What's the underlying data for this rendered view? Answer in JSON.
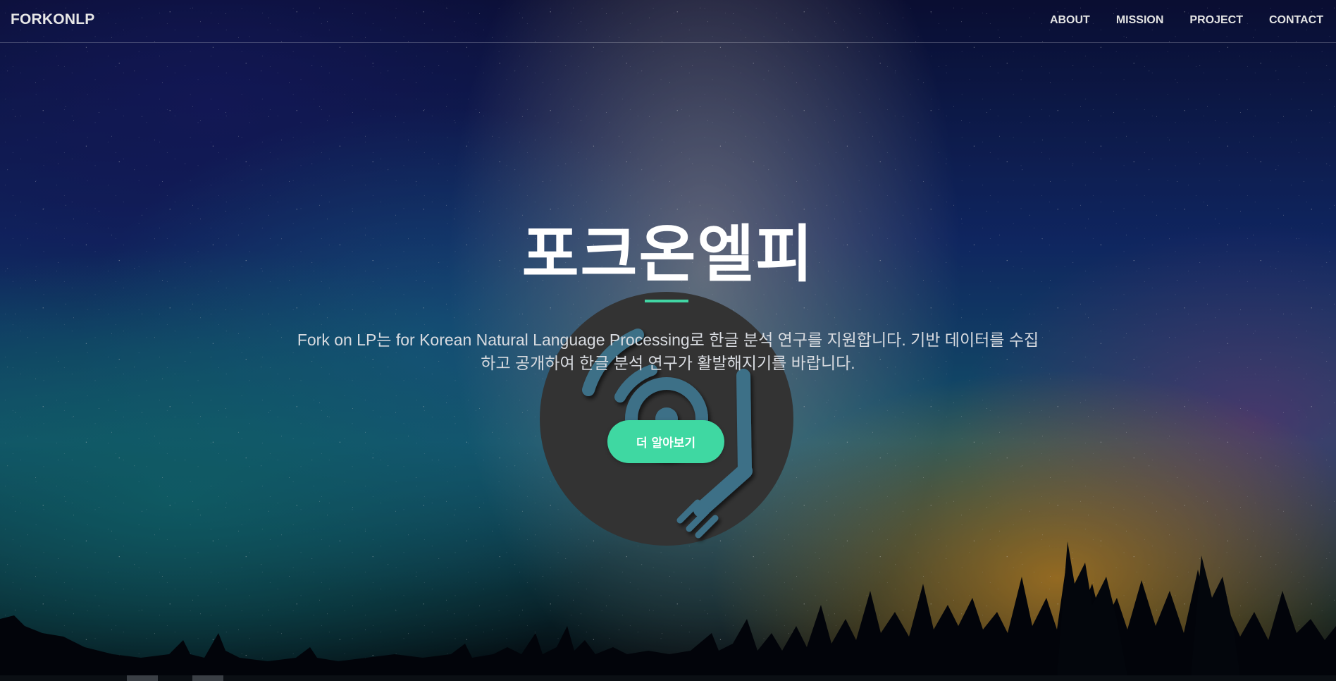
{
  "navbar": {
    "brand": "FORKONLP",
    "items": [
      {
        "label": "ABOUT"
      },
      {
        "label": "MISSION"
      },
      {
        "label": "PROJECT"
      },
      {
        "label": "CONTACT"
      }
    ]
  },
  "hero": {
    "title": "포크온엘피",
    "description": "Fork on LP는 for Korean Natural Language Processing로 한글 분석 연구를 지원합니다. 기반 데이터를 수집하고 공개하여 한글 분석 연구가 활발해지기를 바랍니다.",
    "cta_label": "더 알아보기",
    "logo_icon": "fork-record-icon"
  },
  "colors": {
    "accent": "#3fd8a2",
    "logo_disc": "#333333",
    "logo_inner": "#3d6f87"
  }
}
